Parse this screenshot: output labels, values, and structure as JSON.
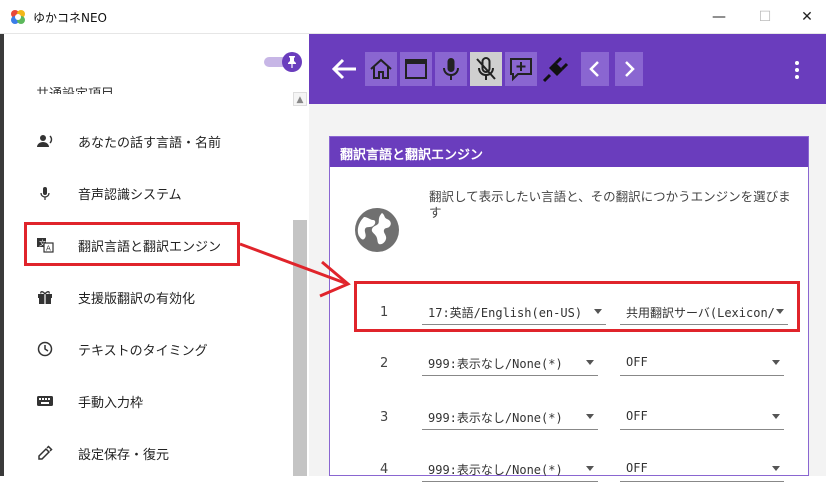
{
  "app": {
    "title": "ゆかコネNEO"
  },
  "window_controls": {
    "minimize": "—",
    "maximize": "☐",
    "close": "✕"
  },
  "sidebar": {
    "cut_heading": "共通設定項目",
    "items": [
      {
        "label": "あなたの話す言語・名前",
        "icon": "speaker-person-icon"
      },
      {
        "label": "音声認識システム",
        "icon": "microphone-icon"
      },
      {
        "label": "翻訳言語と翻訳エンジン",
        "icon": "translate-icon"
      },
      {
        "label": "支援版翻訳の有効化",
        "icon": "gift-icon"
      },
      {
        "label": "テキストのタイミング",
        "icon": "timer-icon"
      },
      {
        "label": "手動入力枠",
        "icon": "keyboard-icon"
      },
      {
        "label": "設定保存・復元",
        "icon": "restore-icon"
      }
    ]
  },
  "toolbar": {
    "buttons": [
      "back-arrow-icon",
      "home-icon",
      "window-icon",
      "microphone-icon",
      "microphone-off-icon",
      "add-comment-icon",
      "plug-icon",
      "chevron-left-icon",
      "chevron-right-icon",
      "more-vert-icon"
    ]
  },
  "card": {
    "header": "翻訳言語と翻訳エンジン",
    "description": "翻訳して表示したい言語と、その翻訳につかうエンジンを選びます",
    "rows": [
      {
        "num": "1",
        "language": "17:英語/English(en-US)",
        "engine": "共用翻訳サーバ(Lexicon/"
      },
      {
        "num": "2",
        "language": "999:表示なし/None(*)",
        "engine": "OFF"
      },
      {
        "num": "3",
        "language": "999:表示なし/None(*)",
        "engine": "OFF"
      },
      {
        "num": "4",
        "language": "999:表示なし/None(*)",
        "engine": "OFF"
      }
    ]
  },
  "colors": {
    "accent": "#6a3dbd",
    "annotation": "#e0242b"
  }
}
